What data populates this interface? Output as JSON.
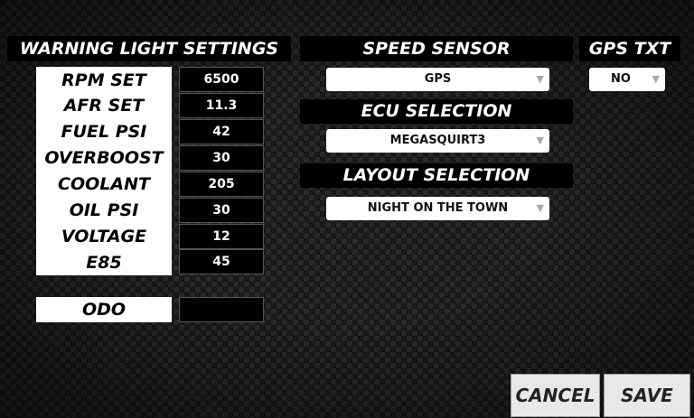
{
  "warning": {
    "title": "WARNING LIGHT SETTINGS",
    "items": [
      {
        "label": "RPM SET",
        "value": "6500"
      },
      {
        "label": "AFR SET",
        "value": "11.3"
      },
      {
        "label": "FUEL PSI",
        "value": "42"
      },
      {
        "label": "OVERBOOST",
        "value": "30"
      },
      {
        "label": "COOLANT",
        "value": "205"
      },
      {
        "label": "OIL PSI",
        "value": "30"
      },
      {
        "label": "VOLTAGE",
        "value": "12"
      },
      {
        "label": "E85",
        "value": "45"
      }
    ],
    "odo_label": "ODO",
    "odo_value": ""
  },
  "speed_sensor": {
    "title": "SPEED SENSOR",
    "selected": "GPS"
  },
  "gps_txt": {
    "title": "GPS TXT",
    "selected": "NO"
  },
  "ecu": {
    "title": "ECU SELECTION",
    "selected": "MEGASQUIRT3"
  },
  "layout": {
    "title": "LAYOUT SELECTION",
    "selected": "NIGHT ON THE TOWN"
  },
  "buttons": {
    "cancel": "CANCEL",
    "save": "SAVE"
  },
  "icons": {
    "dropdown": "chevron-down-icon"
  },
  "colors": {
    "header_bg": "#000000",
    "label_bg": "#ffffff",
    "value_bg": "#000000",
    "button_bg": "#e8e8e8"
  }
}
